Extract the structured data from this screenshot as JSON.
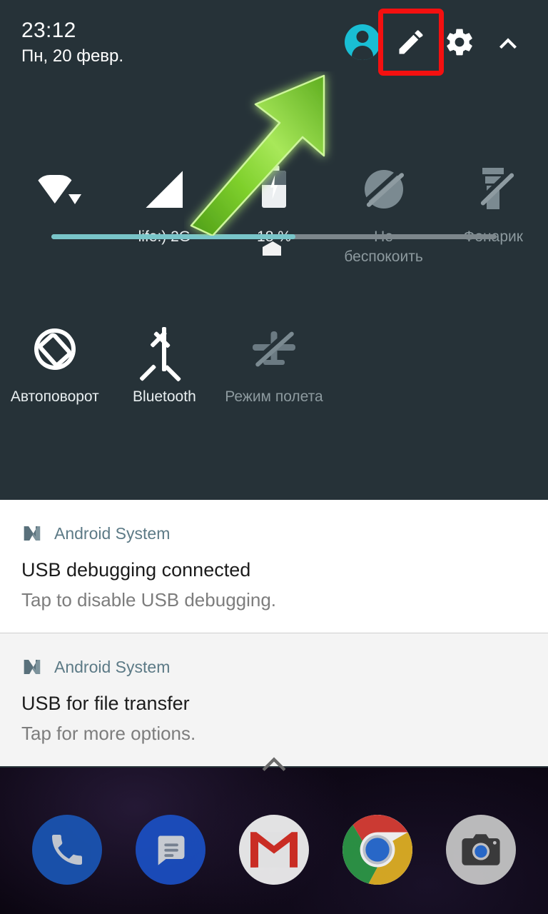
{
  "statusbar": {
    "time": "23:12",
    "date": "Пн, 20 февр."
  },
  "header": {
    "avatar_icon": "user-avatar-icon",
    "edit_icon": "pencil-edit-icon",
    "settings_icon": "gear-icon",
    "collapse_icon": "chevron-up-icon",
    "avatar_color": "#19bed4",
    "highlight_color": "#f41010"
  },
  "brightness": {
    "label": "brightness-slider",
    "value_percent": 55,
    "fill_color": "#79c5c9",
    "track_color": "#7d878c"
  },
  "tiles": {
    "row1": [
      {
        "name": "wifi",
        "icon": "wifi-icon",
        "label": "",
        "state": "on"
      },
      {
        "name": "mobile-data",
        "icon": "signal-cellular-icon",
        "label": "life:) 2G",
        "state": "on"
      },
      {
        "name": "battery",
        "icon": "battery-charging-icon",
        "label": "18 %",
        "state": "on"
      },
      {
        "name": "do-not-disturb",
        "icon": "do-not-disturb-off-icon",
        "label": "Не беспокоить",
        "state": "off"
      },
      {
        "name": "flashlight",
        "icon": "flashlight-off-icon",
        "label": "Фонарик",
        "state": "off"
      }
    ],
    "row2": [
      {
        "name": "auto-rotate",
        "icon": "screen-rotation-icon",
        "label": "Автоповорот",
        "state": "on"
      },
      {
        "name": "bluetooth",
        "icon": "bluetooth-icon",
        "label": "Bluetooth",
        "state": "on"
      },
      {
        "name": "airplane-mode",
        "icon": "airplane-off-icon",
        "label": "Режим полета",
        "state": "off"
      }
    ]
  },
  "notifications": [
    {
      "app": "Android System",
      "app_icon": "android-nougat-logo-icon",
      "title": "USB debugging connected",
      "body": "Tap to disable USB debugging."
    },
    {
      "app": "Android System",
      "app_icon": "android-nougat-logo-icon",
      "title": "USB for file transfer",
      "body": "Tap for more options."
    }
  ],
  "shade": {
    "handle_icon": "chevron-up-icon",
    "background": "#263238"
  },
  "annotation": {
    "arrow_icon": "green-arrow-pointing-up-right",
    "arrow_color": "#74c423",
    "points_at": "pencil-edit-icon"
  },
  "dock": [
    {
      "name": "phone",
      "icon": "phone-icon",
      "color": "#1a56b5"
    },
    {
      "name": "messages",
      "icon": "messages-icon",
      "color": "#1b50c4"
    },
    {
      "name": "gmail",
      "icon": "gmail-icon",
      "color": "#f4f4f4"
    },
    {
      "name": "chrome",
      "icon": "chrome-icon",
      "color": "#ffffff"
    },
    {
      "name": "camera",
      "icon": "camera-icon",
      "color": "#c9c9c9"
    }
  ]
}
